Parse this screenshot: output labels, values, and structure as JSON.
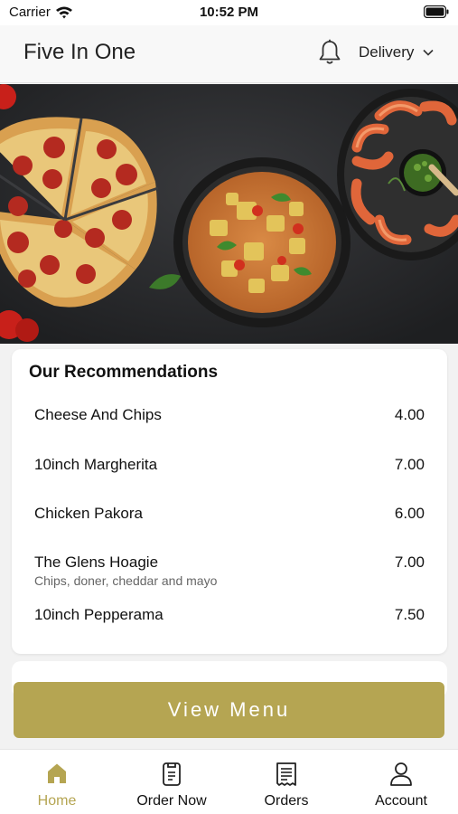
{
  "status_bar": {
    "carrier": "Carrier",
    "time": "10:52 PM"
  },
  "header": {
    "title": "Five In One",
    "delivery_mode": "Delivery"
  },
  "recommendations": {
    "title": "Our Recommendations",
    "items": [
      {
        "name": "Cheese And Chips",
        "price": "4.00",
        "description": ""
      },
      {
        "name": "10inch Margherita",
        "price": "7.00",
        "description": ""
      },
      {
        "name": "Chicken Pakora",
        "price": "6.00",
        "description": ""
      },
      {
        "name": "The Glens Hoagie",
        "price": "7.00",
        "description": "Chips, doner, cheddar and mayo"
      },
      {
        "name": "10inch Pepperama",
        "price": "7.50",
        "description": ""
      }
    ]
  },
  "view_menu_label": "View Menu",
  "tabs": [
    {
      "label": "Home",
      "icon": "home-icon",
      "active": true
    },
    {
      "label": "Order Now",
      "icon": "order-icon",
      "active": false
    },
    {
      "label": "Orders",
      "icon": "receipt-icon",
      "active": false
    },
    {
      "label": "Account",
      "icon": "person-icon",
      "active": false
    }
  ],
  "colors": {
    "accent": "#b5a552",
    "hero_background": "#2a2b2d"
  }
}
